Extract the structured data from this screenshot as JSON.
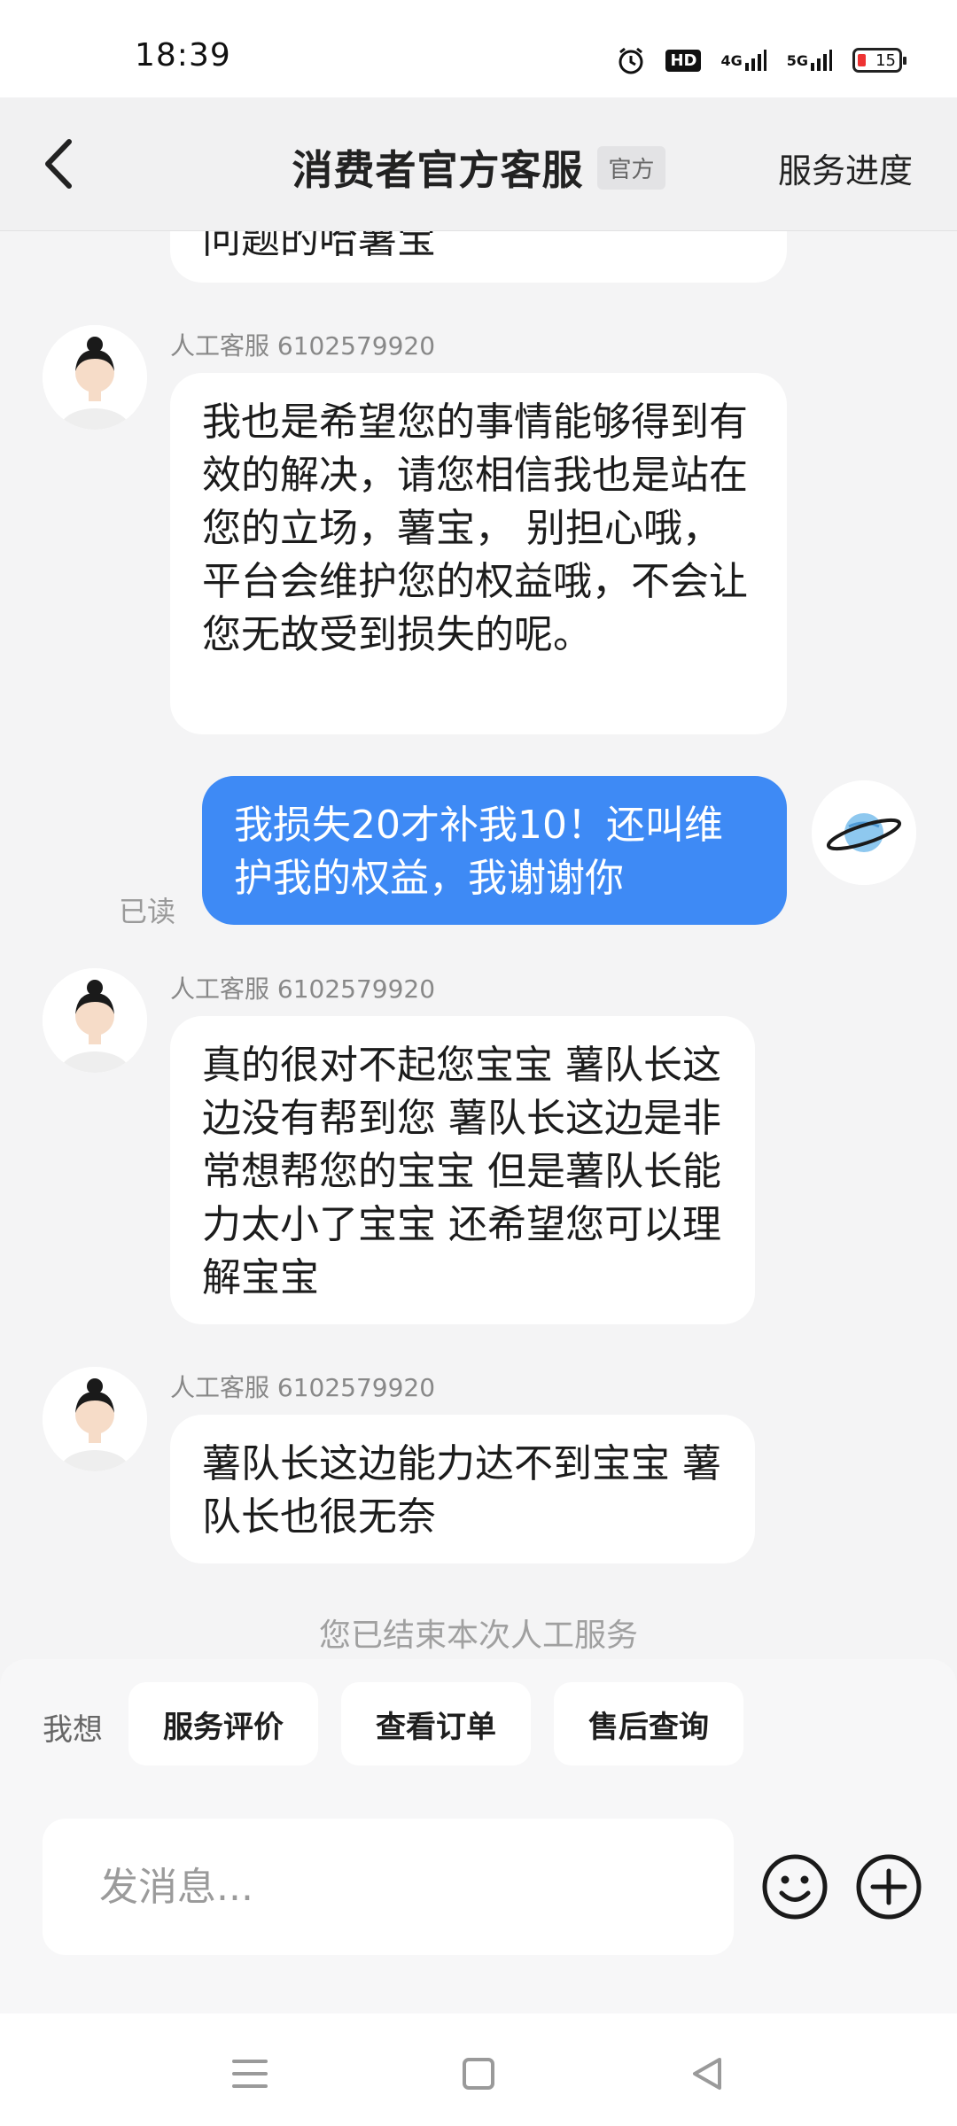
{
  "status_bar": {
    "time": "18:39",
    "hd_label": "HD",
    "network_1": "4G",
    "network_2": "5G",
    "battery": "15"
  },
  "header": {
    "title": "消费者官方客服",
    "badge": "官方",
    "right_link": "服务进度"
  },
  "messages": [
    {
      "from": "agent",
      "sender": "",
      "text": "问题的哈薯宝",
      "partial": true
    },
    {
      "from": "agent",
      "sender": "人工客服 6102579920",
      "text": "我也是希望您的事情能够得到有效的解决，请您相信我也是站在您的立场，薯宝， 别担心哦，平台会维护您的权益哦，不会让您无故受到损失的呢。"
    },
    {
      "from": "user",
      "text": "我损失20才补我10！还叫维护我的权益，我谢谢你",
      "status": "已读"
    },
    {
      "from": "agent",
      "sender": "人工客服 6102579920",
      "text": "真的很对不起您宝宝 薯队长这边没有帮到您 薯队长这边是非常想帮您的宝宝 但是薯队长能力太小了宝宝 还希望您可以理解宝宝"
    },
    {
      "from": "agent",
      "sender": "人工客服 6102579920",
      "text": "薯队长这边能力达不到宝宝 薯队长也很无奈"
    }
  ],
  "system_notice": "您已结束本次人工服务",
  "quick_actions": {
    "label": "我想",
    "items": [
      "服务评价",
      "查看订单",
      "售后查询"
    ]
  },
  "composer": {
    "placeholder": "发消息...",
    "emoji_icon": "smile-icon",
    "plus_icon": "plus-circle-icon"
  },
  "nav_icons": [
    "menu-icon",
    "home-square-icon",
    "back-triangle-icon"
  ],
  "colors": {
    "user_bubble": "#3e8af5",
    "agent_bubble": "#ffffff",
    "background": "#f4f4f5"
  }
}
